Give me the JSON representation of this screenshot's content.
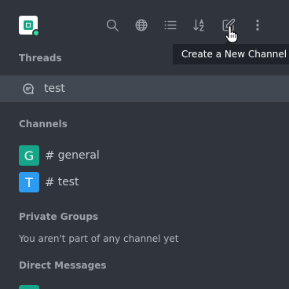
{
  "header": {
    "tooltip": "Create a New Channel",
    "tools": [
      {
        "icon": "search-icon"
      },
      {
        "icon": "globe-icon"
      },
      {
        "icon": "list-view-icon"
      },
      {
        "icon": "sort-az-icon"
      },
      {
        "icon": "edit-pencil-icon"
      },
      {
        "icon": "kebab-menu-icon"
      }
    ],
    "avatar_color": "#17a589",
    "status_color": "#2de0a5"
  },
  "sections": {
    "threads": "Threads",
    "channels": "Channels",
    "private_groups": "Private Groups",
    "direct_messages": "Direct Messages"
  },
  "threads": [
    {
      "name": "test"
    }
  ],
  "channels": [
    {
      "initial": "G",
      "hash": "#",
      "name": "general",
      "color": "#17a589"
    },
    {
      "initial": "T",
      "hash": "#",
      "name": "test",
      "color": "#2d9cf0"
    }
  ],
  "private_groups": {
    "empty_text": "You aren't part of any channel yet"
  }
}
